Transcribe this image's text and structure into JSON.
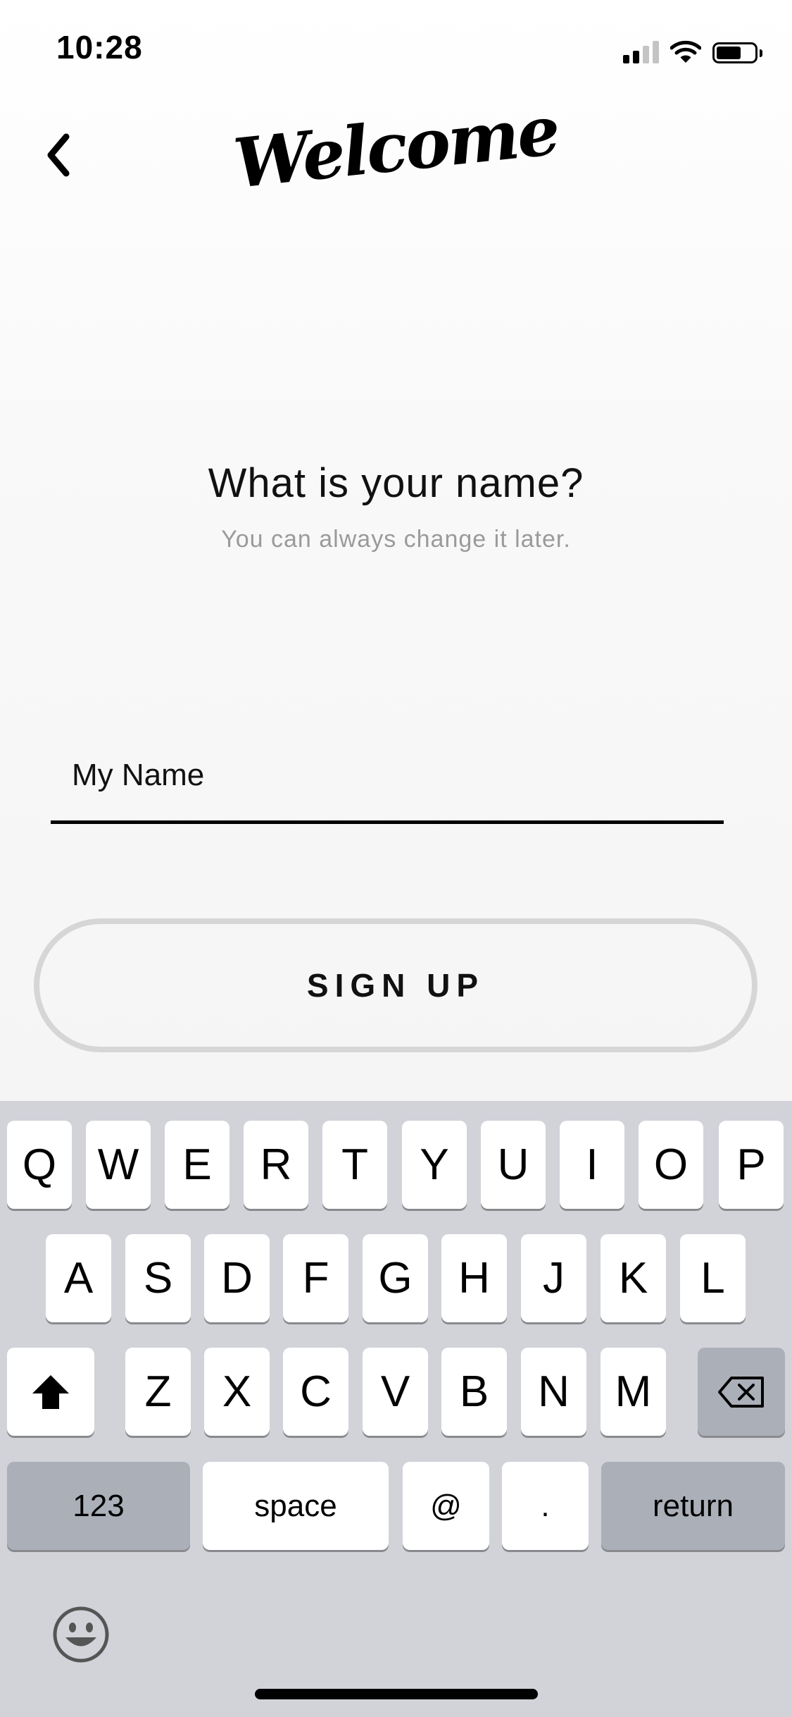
{
  "status_bar": {
    "time": "10:28",
    "icons": [
      "signal-icon",
      "wifi-icon",
      "battery-icon"
    ]
  },
  "nav": {
    "back_icon": "chevron-left-icon",
    "title": "Welcome"
  },
  "prompt": {
    "question": "What is your name?",
    "hint": "You can always change it later."
  },
  "name_field": {
    "placeholder": "My Name",
    "value": ""
  },
  "signup_button": {
    "label": "SIGN UP"
  },
  "keyboard": {
    "row1": [
      "Q",
      "W",
      "E",
      "R",
      "T",
      "Y",
      "U",
      "I",
      "O",
      "P"
    ],
    "row2": [
      "A",
      "S",
      "D",
      "F",
      "G",
      "H",
      "J",
      "K",
      "L"
    ],
    "row3": [
      "Z",
      "X",
      "C",
      "V",
      "B",
      "N",
      "M"
    ],
    "shift_icon": "shift-icon",
    "delete_icon": "delete-icon",
    "numbers_label": "123",
    "space_label": "space",
    "at_label": "@",
    "dot_label": ".",
    "return_label": "return",
    "emoji_icon": "emoji-icon"
  },
  "colors": {
    "text": "#000000",
    "hint_text": "#9a9a9a",
    "button_border": "#d6d6d6",
    "keyboard_bg": "#d1d3d9",
    "key_gray": "#abafb8"
  }
}
